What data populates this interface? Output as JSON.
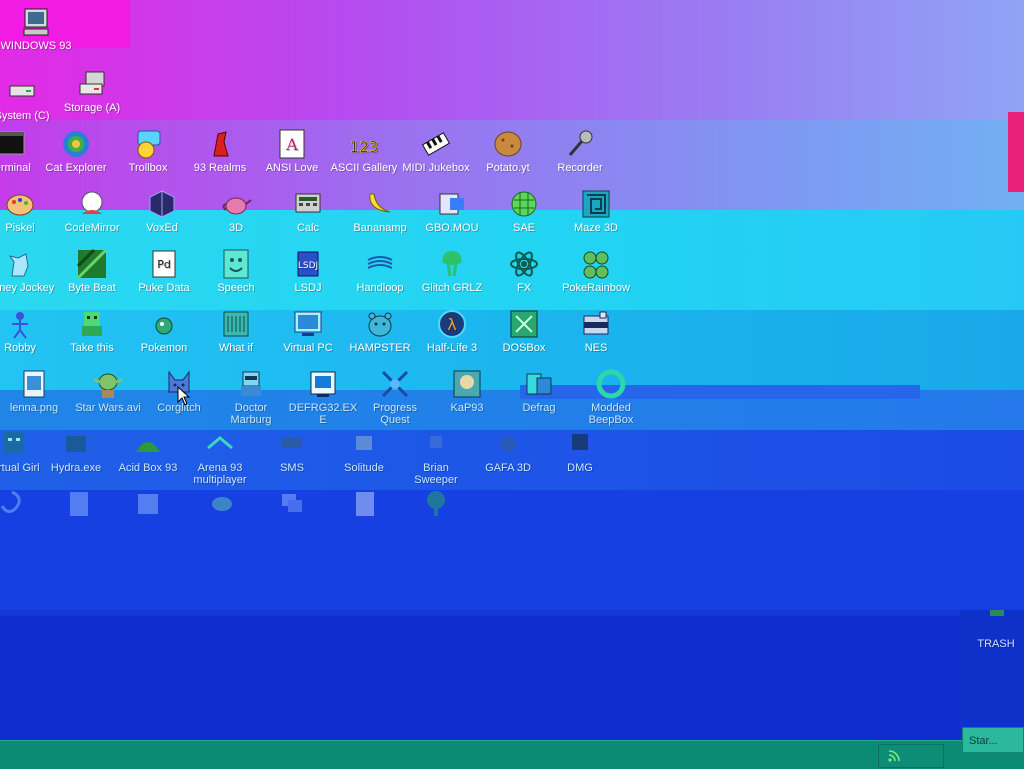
{
  "desktop": {
    "row_os": [
      {
        "label": "WINDOWS 93",
        "icon": "computer-icon"
      }
    ],
    "row_drives": [
      {
        "label": "System (C)",
        "icon": "hard-drive-icon"
      },
      {
        "label": "Storage (A)",
        "icon": "storage-icon"
      }
    ],
    "row1": [
      {
        "label": "Terminal",
        "icon": "terminal-icon"
      },
      {
        "label": "Cat Explorer",
        "icon": "cat-explorer-icon"
      },
      {
        "label": "Trollbox",
        "icon": "trollbox-icon"
      },
      {
        "label": "93 Realms",
        "icon": "realms-icon"
      },
      {
        "label": "ANSI Love",
        "icon": "ansi-love-icon"
      },
      {
        "label": "ASCII Gallery",
        "icon": "ascii-gallery-icon"
      },
      {
        "label": "MIDI Jukebox",
        "icon": "midi-jukebox-icon"
      },
      {
        "label": "Potato.yt",
        "icon": "potato-icon"
      },
      {
        "label": "Recorder",
        "icon": "microphone-icon"
      }
    ],
    "row2": [
      {
        "label": "Piskel",
        "icon": "palette-icon"
      },
      {
        "label": "CodeMirror",
        "icon": "codemirror-icon"
      },
      {
        "label": "VoxEd",
        "icon": "voxel-cube-icon"
      },
      {
        "label": "3D",
        "icon": "teapot-icon"
      },
      {
        "label": "Calc",
        "icon": "calculator-icon"
      },
      {
        "label": "Bananamp",
        "icon": "banana-icon"
      },
      {
        "label": "GBO.MOU",
        "icon": "gbo-icon"
      },
      {
        "label": "SAE",
        "icon": "sae-icon"
      },
      {
        "label": "Maze 3D",
        "icon": "maze-icon"
      }
    ],
    "row3": [
      {
        "label": "Poney Jockey",
        "icon": "pony-icon"
      },
      {
        "label": "Byte Beat",
        "icon": "bytebeat-icon"
      },
      {
        "label": "Puke Data",
        "icon": "puke-data-icon"
      },
      {
        "label": "Speech",
        "icon": "speech-icon"
      },
      {
        "label": "LSDJ",
        "icon": "lsdj-icon"
      },
      {
        "label": "Handloop",
        "icon": "handloop-icon"
      },
      {
        "label": "Glitch GRLZ",
        "icon": "glitch-girl-icon"
      },
      {
        "label": "FX",
        "icon": "fx-icon"
      },
      {
        "label": "PokeRainbow",
        "icon": "pokerainbow-icon"
      }
    ],
    "row4": [
      {
        "label": "Robby",
        "icon": "robby-icon"
      },
      {
        "label": "Take this",
        "icon": "take-this-icon"
      },
      {
        "label": "Pokemon",
        "icon": "pokemon-icon"
      },
      {
        "label": "What if",
        "icon": "what-if-icon"
      },
      {
        "label": "Virtual PC",
        "icon": "virtual-pc-icon"
      },
      {
        "label": "HAMPSTER",
        "icon": "hamster-icon"
      },
      {
        "label": "Half-Life 3",
        "icon": "half-life-icon"
      },
      {
        "label": "DOSBox",
        "icon": "dosbox-icon"
      },
      {
        "label": "NES",
        "icon": "nes-icon"
      }
    ],
    "row5": [
      {
        "label": "lenna.png",
        "icon": "image-file-icon"
      },
      {
        "label": "Star Wars.avi",
        "icon": "yoda-icon"
      },
      {
        "label": "Corglitch",
        "icon": "corgi-icon"
      },
      {
        "label": "Doctor Marburg",
        "icon": "doctor-icon"
      },
      {
        "label": "DEFRG32.EXE",
        "icon": "defrag-exe-icon"
      },
      {
        "label": "Progress Quest",
        "icon": "progress-quest-icon"
      },
      {
        "label": "KaP93",
        "icon": "kap-icon"
      },
      {
        "label": "Defrag",
        "icon": "defrag-icon"
      },
      {
        "label": "Modded BeepBox",
        "icon": "beepbox-icon"
      }
    ],
    "row6": [
      {
        "label": "Virtual Girl",
        "icon": "virtual-girl-icon"
      },
      {
        "label": "Hydra.exe",
        "icon": "hydra-icon"
      },
      {
        "label": "Acid Box 93",
        "icon": "acid-box-icon"
      },
      {
        "label": "Arena 93 multiplayer",
        "icon": "arena-icon"
      },
      {
        "label": "SMS",
        "icon": "sms-icon"
      },
      {
        "label": "Solitude",
        "icon": "solitude-icon"
      },
      {
        "label": "Brian Sweeper",
        "icon": "brian-sweeper-icon"
      },
      {
        "label": "GAFA 3D",
        "icon": "gafa-icon"
      },
      {
        "label": "DMG",
        "icon": "dmg-icon"
      }
    ],
    "row7": [
      {
        "label": "",
        "icon": "swirl-icon"
      },
      {
        "label": "",
        "icon": "doc-file-icon"
      },
      {
        "label": "",
        "icon": "notepad-icon"
      },
      {
        "label": "",
        "icon": "bug-icon"
      },
      {
        "label": "",
        "icon": "windows-stack-icon"
      },
      {
        "label": "",
        "icon": "text-file-icon"
      },
      {
        "label": "",
        "icon": "tree-icon"
      }
    ],
    "trash": {
      "label": "TRASH",
      "icon": "trash-icon"
    }
  },
  "taskbar": {
    "tray_icon": "rss-icon",
    "window_button": "Star..."
  },
  "colors": {
    "magenta": "#e22be8",
    "violet": "#b651f0",
    "cyan": "#1fd6f2",
    "sky": "#19b7ee",
    "blue": "#1947e6",
    "deep_blue": "#0e24c9",
    "taskbar": "#0b8a74"
  }
}
